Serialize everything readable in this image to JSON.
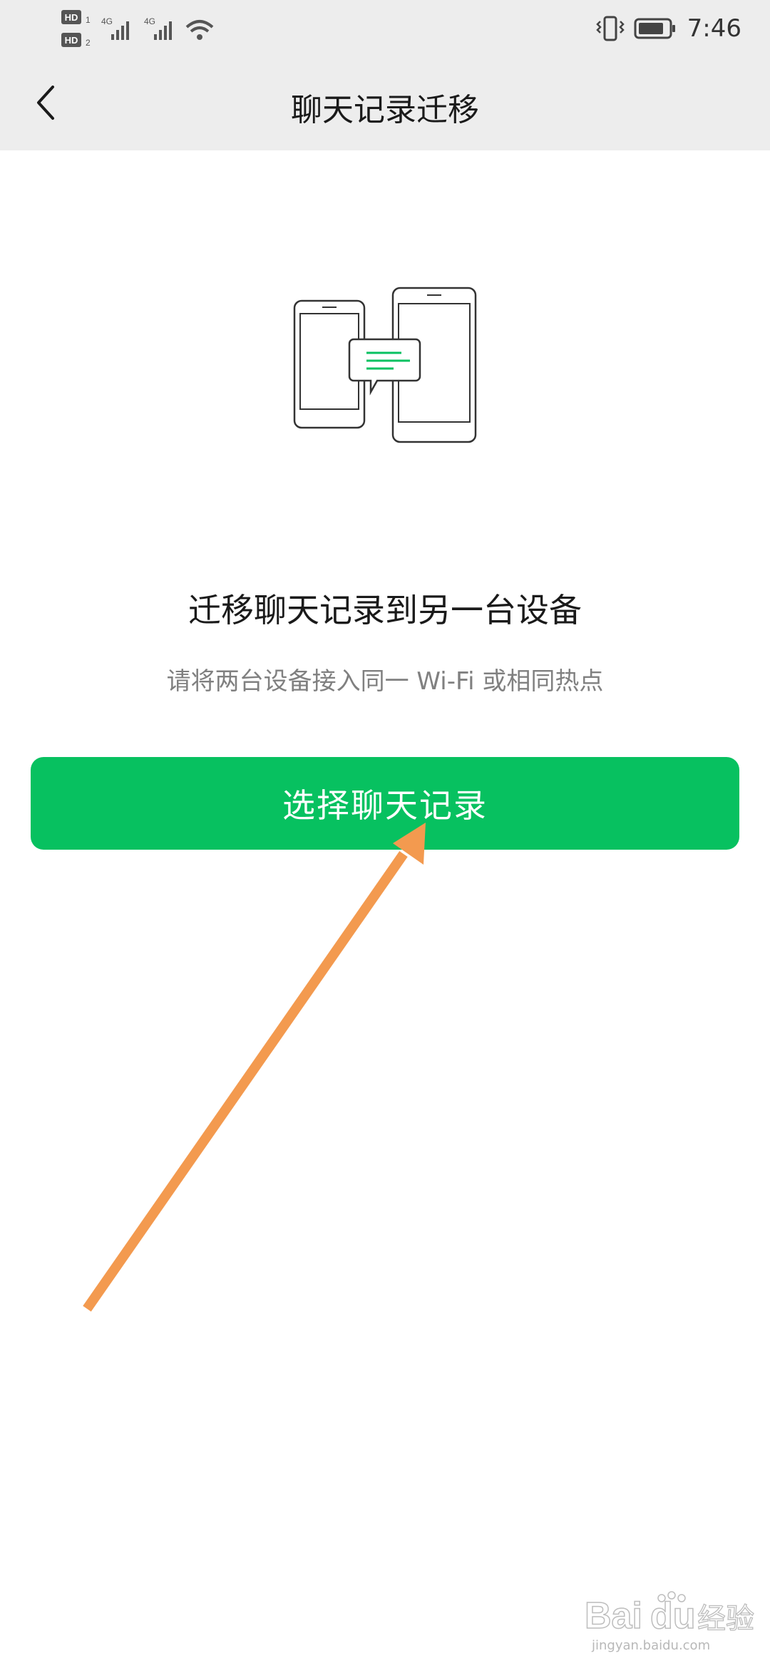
{
  "status_bar": {
    "sim1_badge": "HD",
    "sim1_index": "1",
    "sim2_badge": "HD",
    "sim2_index": "2",
    "network1": "4G",
    "network2": "4G",
    "time": "7:46",
    "icons": [
      "signal-icon",
      "wifi-icon",
      "vibrate-icon",
      "battery-icon"
    ]
  },
  "header": {
    "back_icon": "chevron-left-icon",
    "title": "聊天记录迁移",
    "background": "#ededed"
  },
  "main": {
    "illustration_icon": "phone-transfer-icon",
    "heading": "迁移聊天记录到另一台设备",
    "subtext": "请将两台设备接入同一 Wi-Fi 或相同热点",
    "button_label": "选择聊天记录",
    "button_color": "#07c160",
    "accent_color": "#07c160"
  },
  "overlay": {
    "arrow_icon": "annotation-arrow-icon",
    "arrow_color": "#f39a4f"
  },
  "watermark": {
    "brand": "Bai du 经验",
    "url": "jingyan.baidu.com"
  }
}
